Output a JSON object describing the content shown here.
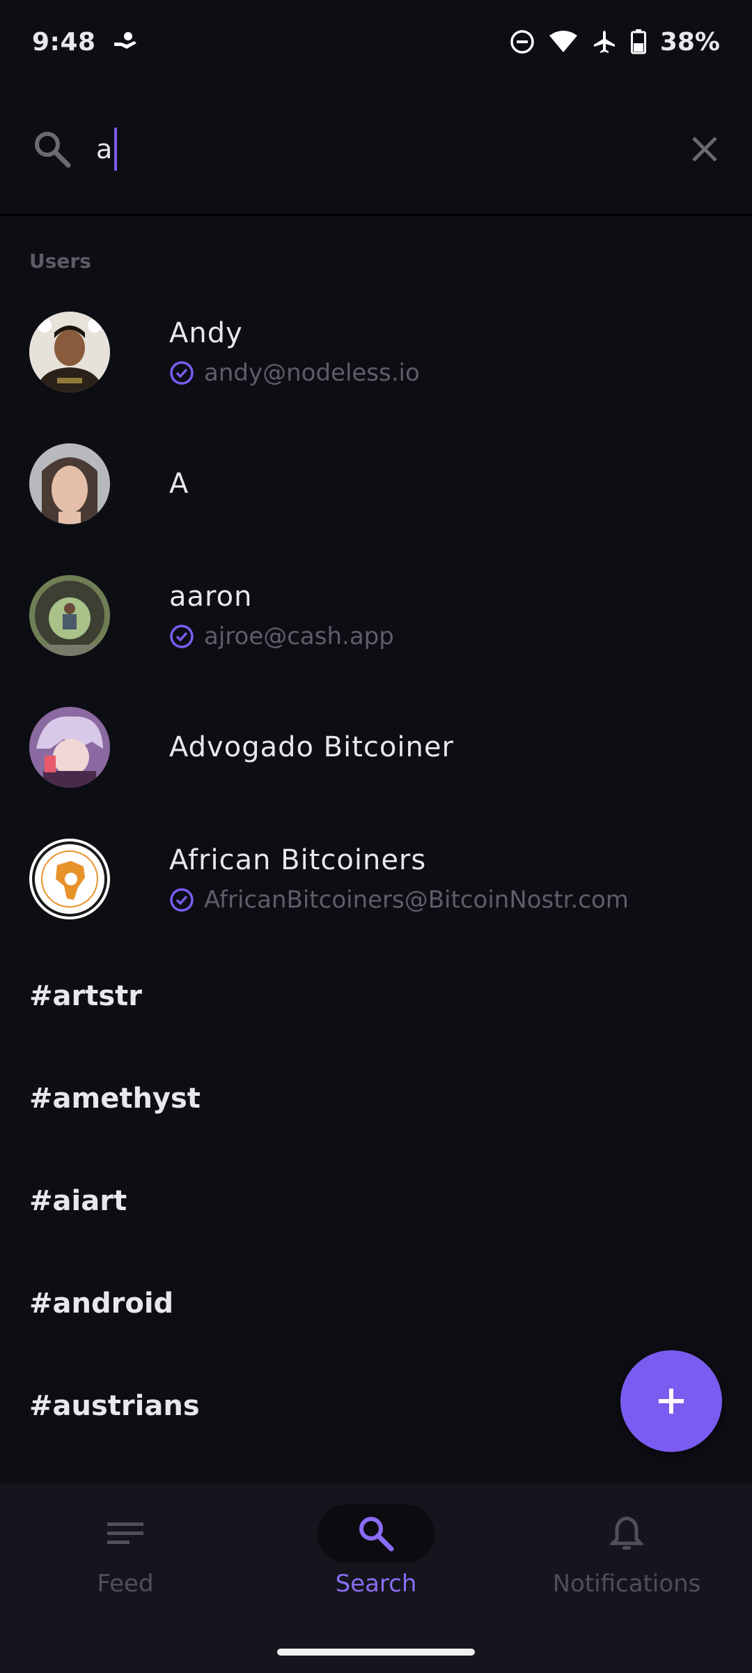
{
  "status_bar": {
    "time": "9:48",
    "battery": "38%"
  },
  "search": {
    "value": "a"
  },
  "users_section": {
    "label": "Users",
    "users": [
      {
        "name": "Andy",
        "nip05": "andy@nodeless.io"
      },
      {
        "name": "A",
        "nip05": ""
      },
      {
        "name": "aaron",
        "nip05": "ajroe@cash.app"
      },
      {
        "name": "Advogado Bitcoiner",
        "nip05": ""
      },
      {
        "name": "African Bitcoiners",
        "nip05": "AfricanBitcoiners@BitcoinNostr.com"
      }
    ]
  },
  "hashtags": [
    "#artstr",
    "#amethyst",
    "#aiart",
    "#android",
    "#austrians"
  ],
  "bottom_nav": {
    "items": [
      {
        "label": "Feed",
        "icon": "feed-icon",
        "active": false
      },
      {
        "label": "Search",
        "icon": "search-icon",
        "active": true
      },
      {
        "label": "Notifications",
        "icon": "bell-icon",
        "active": false
      }
    ]
  },
  "colors": {
    "accent": "#7b5cf0",
    "background": "#0d0d14",
    "nav_background": "#15151d"
  }
}
